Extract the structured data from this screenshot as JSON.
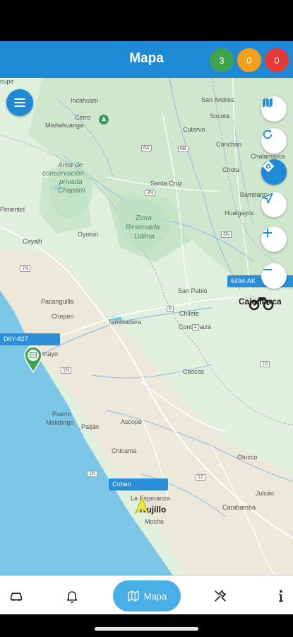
{
  "header": {
    "title": "Mapa"
  },
  "badges": {
    "green": "3",
    "orange": "0",
    "red": "0"
  },
  "map": {
    "labels": {
      "cupe": "cupe",
      "incahuasi": "Incahuasi",
      "cerro": "Cerro",
      "mishahuanga": "Mishahuanga",
      "area_conservacion_1": "Área de",
      "area_conservacion_2": "conservación",
      "area_conservacion_3": "privada",
      "area_conservacion_4": "Chaparri",
      "oyotun": "Oyotún",
      "zona_reservada_1": "Zona",
      "zona_reservada_2": "Reservada",
      "zona_reservada_3": "Udima",
      "cayalti": "Cayalti",
      "pacanguilla": "Pacanguilla",
      "chepen": "Chepen",
      "pacasmayo": "Pacasmayo",
      "tembladera": "Tembladera",
      "chilete": "Chilete",
      "san_pablo": "San Pablo",
      "contumaza": "Contumazá",
      "cascas": "Cascas",
      "puerto_malabrigo_1": "Puerto",
      "puerto_malabrigo_2": "Malabrigo",
      "paijan": "Paiján",
      "ascope": "Ascope",
      "chicama": "Chicama",
      "la_esperanza": "La Esperanza",
      "trujillo": "Trujillo",
      "moche": "Moche",
      "otuzco": "Otuzco",
      "julcan": "Julcán",
      "carabamba": "Carabamba",
      "cajamarca": "Cajamarca",
      "san_andres": "San Andres",
      "socota": "Socota",
      "cutervo": "Cutervo",
      "conchan": "Conchán",
      "chalamarca": "Chalamarca",
      "chota": "Chota",
      "bambamarca": "Bambamarca",
      "hualgayoc": "Hualgayoc",
      "santa_cruz": "Santa Cruz",
      "pimentel": "Pimentel"
    },
    "road_shields": [
      "6A",
      "3N",
      "6B",
      "1N",
      "3N",
      "8",
      "4",
      "1N",
      "10",
      "1N",
      "12"
    ],
    "vehicles": [
      {
        "plate": "D6Y-827"
      },
      {
        "plate": "6494-AK"
      },
      {
        "plate": "Coban"
      }
    ]
  },
  "nav": {
    "active_label": "Mapa"
  },
  "colors": {
    "primary": "#1e8ad6",
    "sea": "#7cc7e8",
    "land": "#dff0dc",
    "active_pill": "#48aee6"
  },
  "icons": [
    "menu-icon",
    "map-icon",
    "refresh-icon",
    "location-target-icon",
    "navigate-arrow-icon",
    "zoom-in-icon",
    "zoom-out-icon",
    "car-icon",
    "bell-icon",
    "map-icon",
    "tools-icon",
    "info-icon"
  ]
}
